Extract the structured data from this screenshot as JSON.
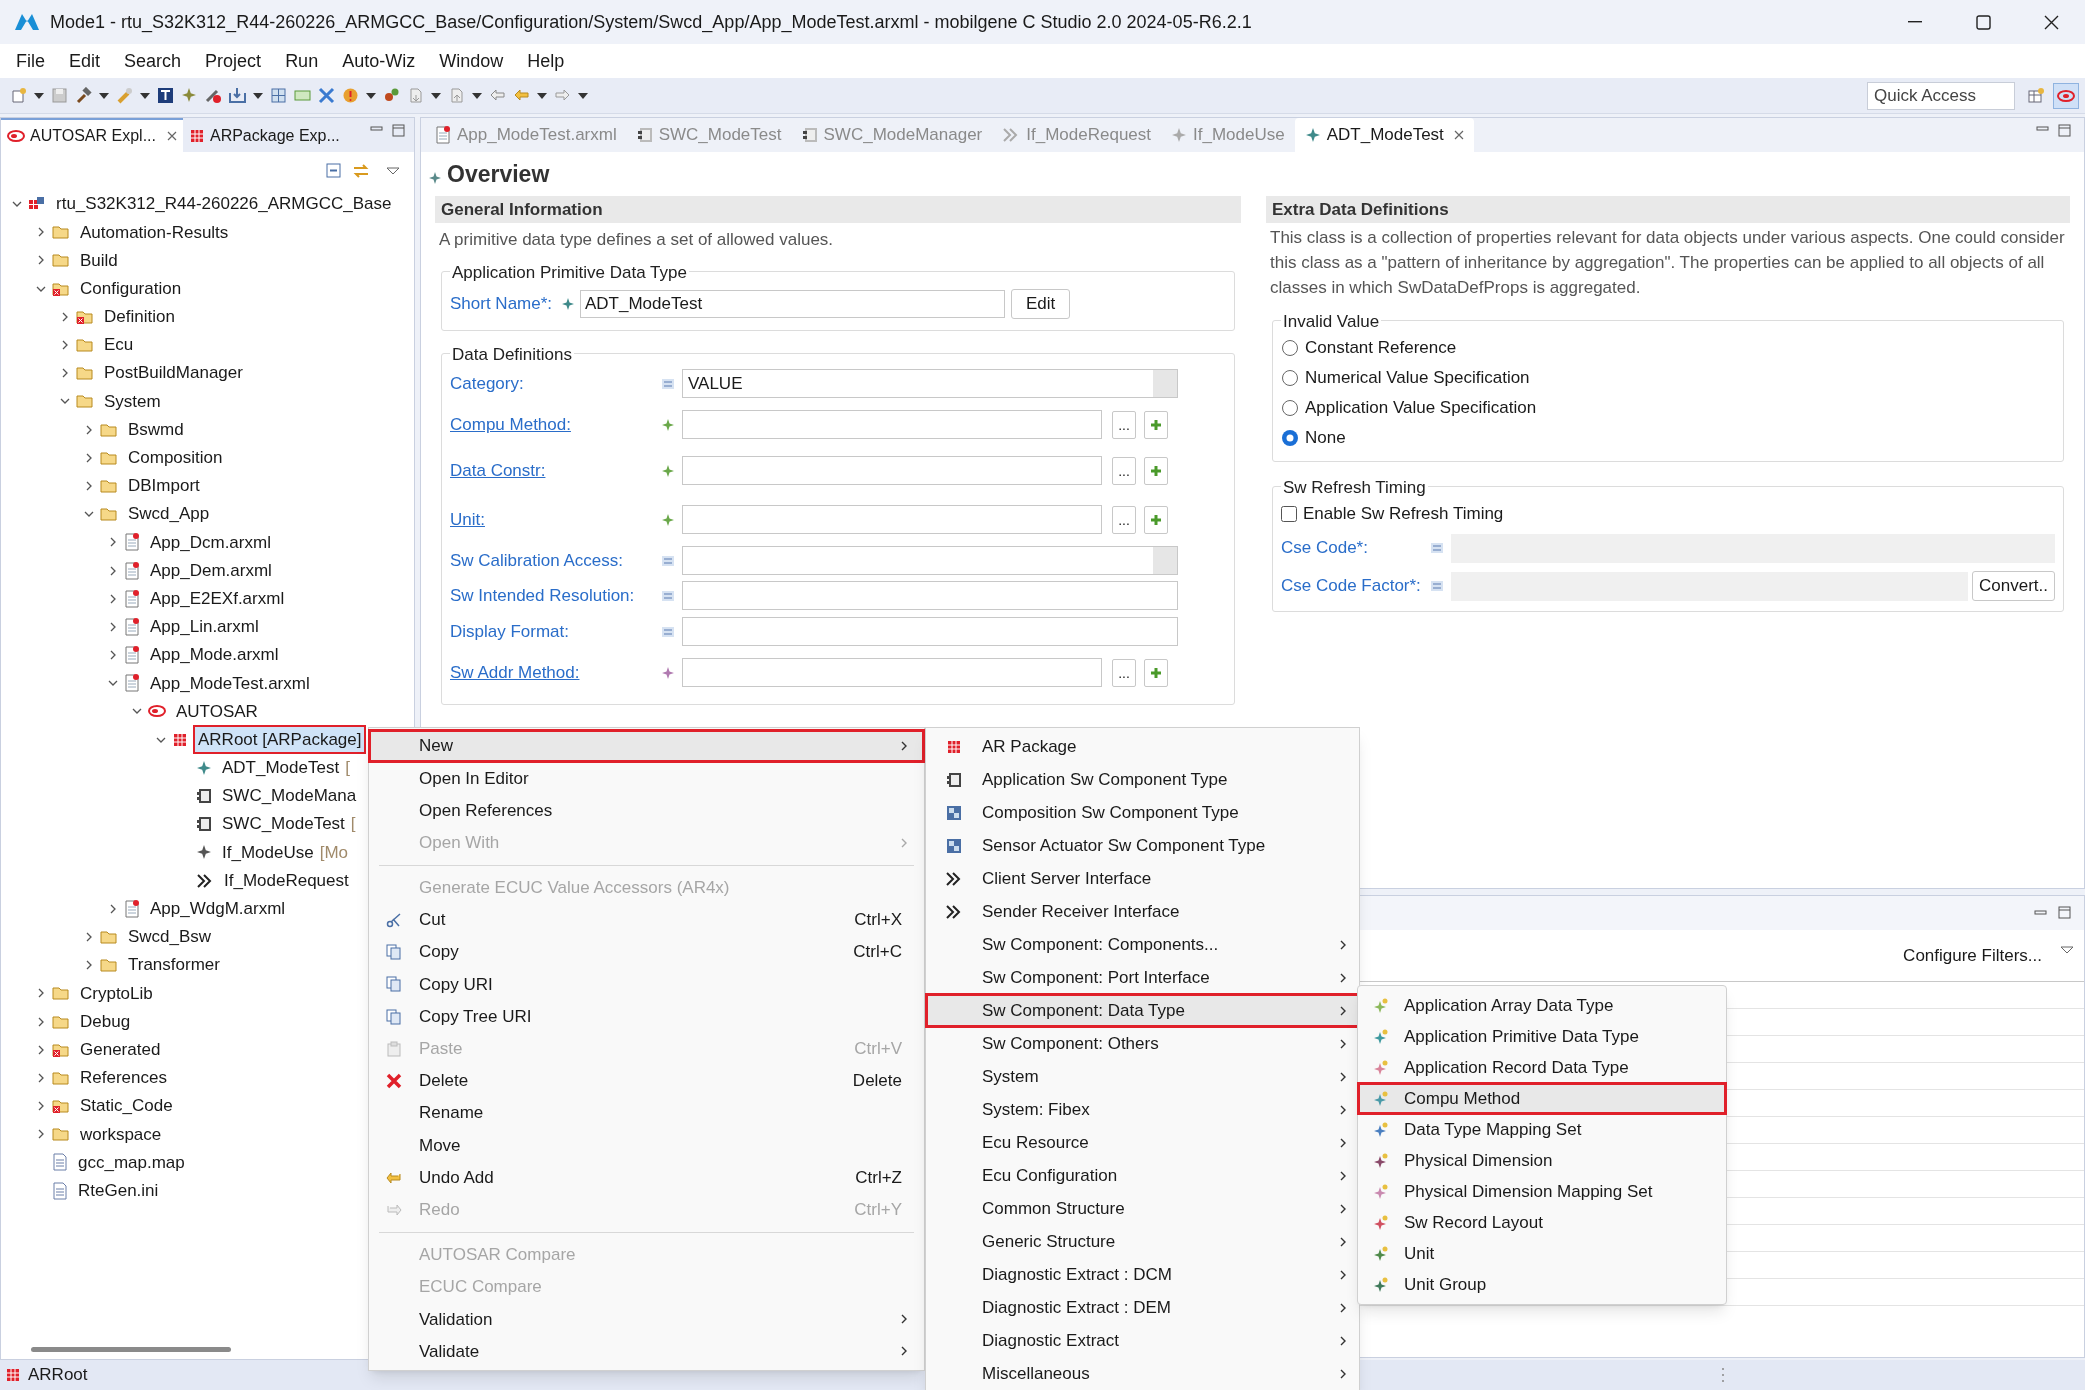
{
  "window": {
    "title": "Mode1 - rtu_S32K312_R44-260226_ARMGCC_Base/Configuration/System/Swcd_App/App_ModeTest.arxml - mobilgene C Studio 2.0 2024-05-R6.2.1"
  },
  "menu_bar": [
    "File",
    "Edit",
    "Search",
    "Project",
    "Run",
    "Auto-Wiz",
    "Window",
    "Help"
  ],
  "quick_access": {
    "placeholder": "Quick Access"
  },
  "left_tabs": [
    {
      "label": "AUTOSAR Expl...",
      "kind": "autosar",
      "selected": true
    },
    {
      "label": "ARPackage Exp...",
      "kind": "package",
      "selected": false
    }
  ],
  "tree": [
    {
      "label": "rtu_S32K312_R44-260226_ARMGCC_Base",
      "kind": "project",
      "expanded": true,
      "selected": false,
      "children": [
        {
          "label": "Automation-Results",
          "kind": "folder",
          "expanded": false,
          "selected": false
        },
        {
          "label": "Build",
          "kind": "folder",
          "expanded": false,
          "selected": false
        },
        {
          "label": "Configuration",
          "kind": "folder-error",
          "expanded": true,
          "selected": false,
          "children": [
            {
              "label": "Definition",
              "kind": "folder-error",
              "expanded": false,
              "selected": false
            },
            {
              "label": "Ecu",
              "kind": "folder",
              "expanded": false,
              "selected": false
            },
            {
              "label": "PostBuildManager",
              "kind": "folder",
              "expanded": false,
              "selected": false
            },
            {
              "label": "System",
              "kind": "folder",
              "expanded": true,
              "selected": false,
              "children": [
                {
                  "label": "Bswmd",
                  "kind": "folder",
                  "expanded": false,
                  "selected": false
                },
                {
                  "label": "Composition",
                  "kind": "folder",
                  "expanded": false,
                  "selected": false
                },
                {
                  "label": "DBImport",
                  "kind": "folder",
                  "expanded": false,
                  "selected": false
                },
                {
                  "label": "Swcd_App",
                  "kind": "folder",
                  "expanded": true,
                  "selected": false,
                  "children": [
                    {
                      "label": "App_Dcm.arxml",
                      "kind": "arxml",
                      "expanded": false,
                      "selected": false
                    },
                    {
                      "label": "App_Dem.arxml",
                      "kind": "arxml",
                      "expanded": false,
                      "selected": false
                    },
                    {
                      "label": "App_E2EXf.arxml",
                      "kind": "arxml",
                      "expanded": false,
                      "selected": false
                    },
                    {
                      "label": "App_Lin.arxml",
                      "kind": "arxml",
                      "expanded": false,
                      "selected": false
                    },
                    {
                      "label": "App_Mode.arxml",
                      "kind": "arxml",
                      "expanded": false,
                      "selected": false
                    },
                    {
                      "label": "App_ModeTest.arxml",
                      "kind": "arxml",
                      "expanded": true,
                      "selected": false,
                      "children": [
                        {
                          "label": "AUTOSAR",
                          "kind": "autosar",
                          "expanded": true,
                          "selected": false,
                          "children": [
                            {
                              "label": "ARRoot [ARPackage]",
                              "kind": "package",
                              "expanded": true,
                              "selected": true,
                              "children": [
                                {
                                  "label": "ADT_ModeTest",
                                  "suffix": "[",
                                  "kind": "datatype",
                                  "selected": false
                                },
                                {
                                  "label": "SWC_ModeMana",
                                  "kind": "component",
                                  "selected": false
                                },
                                {
                                  "label": "SWC_ModeTest",
                                  "suffix": "[",
                                  "kind": "component",
                                  "selected": false
                                },
                                {
                                  "label": "If_ModeUse",
                                  "suffix": "[Mo",
                                  "kind": "interface",
                                  "selected": false
                                },
                                {
                                  "label": "If_ModeRequest",
                                  "kind": "request",
                                  "selected": false
                                }
                              ]
                            }
                          ]
                        }
                      ]
                    },
                    {
                      "label": "App_WdgM.arxml",
                      "kind": "arxml",
                      "expanded": false,
                      "selected": false
                    }
                  ]
                },
                {
                  "label": "Swcd_Bsw",
                  "kind": "folder",
                  "expanded": false,
                  "selected": false
                },
                {
                  "label": "Transformer",
                  "kind": "folder",
                  "expanded": false,
                  "selected": false
                }
              ]
            }
          ]
        },
        {
          "label": "CryptoLib",
          "kind": "folder",
          "expanded": false,
          "selected": false
        },
        {
          "label": "Debug",
          "kind": "folder",
          "expanded": false,
          "selected": false
        },
        {
          "label": "Generated",
          "kind": "folder-error",
          "expanded": false,
          "selected": false
        },
        {
          "label": "References",
          "kind": "folder",
          "expanded": false,
          "selected": false
        },
        {
          "label": "Static_Code",
          "kind": "folder-error",
          "expanded": false,
          "selected": false
        },
        {
          "label": "workspace",
          "kind": "folder",
          "expanded": false,
          "selected": false
        },
        {
          "label": "gcc_map.map",
          "kind": "file",
          "selected": false
        },
        {
          "label": "RteGen.ini",
          "kind": "file",
          "selected": false
        }
      ]
    }
  ],
  "editor_tabs": [
    {
      "label": "App_ModeTest.arxml",
      "kind": "arxml",
      "selected": false
    },
    {
      "label": "SWC_ModeTest",
      "kind": "component",
      "selected": false
    },
    {
      "label": "SWC_ModeManager",
      "kind": "component",
      "selected": false
    },
    {
      "label": "If_ModeRequest",
      "kind": "request",
      "selected": false
    },
    {
      "label": "If_ModeUse",
      "kind": "interface",
      "selected": false
    },
    {
      "label": "ADT_ModeTest",
      "kind": "datatype",
      "selected": true
    }
  ],
  "overview": {
    "title": "Overview",
    "general": {
      "heading": "General Information",
      "description": "A primitive data type defines a set of allowed values.",
      "group": "Application Primitive Data Type",
      "short_name": {
        "label": "Short Name*:",
        "value": "ADT_ModeTest",
        "button": "Edit"
      },
      "data_group": "Data Definitions",
      "fields": [
        {
          "label": "Category:",
          "kind": "combo",
          "link": false,
          "value": "VALUE"
        },
        {
          "label": "Compu Method:",
          "kind": "reference",
          "link": true,
          "browse": "..."
        },
        {
          "label": "Data Constr:",
          "kind": "reference",
          "link": true,
          "browse": "..."
        },
        {
          "label": "Unit:",
          "kind": "reference",
          "link": true,
          "browse": "..."
        },
        {
          "label": "Sw Calibration Access:",
          "kind": "combo",
          "link": false
        },
        {
          "label": "Sw Intended Resolution:",
          "kind": "text",
          "link": false
        },
        {
          "label": "Display Format:",
          "kind": "text",
          "link": false
        },
        {
          "label": "Sw Addr Method:",
          "kind": "addr",
          "link": true,
          "browse": "..."
        }
      ]
    },
    "extra": {
      "heading": "Extra Data Definitions",
      "description": "This class is a collection of properties relevant for data objects under various aspects. One could consider this class as a \"pattern of inheritance by aggregation\". The properties can be applied to all objects of all classes in which SwDataDefProps is aggregated.",
      "invalid_value": {
        "label": "Invalid Value",
        "options": [
          {
            "label": "Constant Reference",
            "selected": false
          },
          {
            "label": "Numerical Value Specification",
            "selected": false
          },
          {
            "label": "Application Value Specification",
            "selected": false
          },
          {
            "label": "None",
            "selected": true
          }
        ]
      },
      "refresh": {
        "label": "Sw Refresh Timing",
        "checkbox": {
          "label": "Enable Sw Refresh Timing",
          "checked": false
        },
        "fields": [
          {
            "label": "Cse Code*:",
            "disabled": true
          },
          {
            "label": "Cse Code Factor*:",
            "disabled": true,
            "button": "Convert.."
          }
        ]
      }
    }
  },
  "lower_panel": {
    "filter_button": "Configure Filters..."
  },
  "context_menu": [
    {
      "label": "New",
      "kind": "plain",
      "submenu": true,
      "disabled": false,
      "selected": true
    },
    {
      "label": "Open In Editor",
      "kind": "plain",
      "disabled": false,
      "selected": false
    },
    {
      "label": "Open References",
      "kind": "plain",
      "disabled": false,
      "selected": false
    },
    {
      "label": "Open With",
      "kind": "plain",
      "submenu": true,
      "disabled": true,
      "selected": false
    },
    {
      "kind": "separator"
    },
    {
      "label": "Generate ECUC Value Accessors (AR4x)",
      "kind": "plain",
      "disabled": true,
      "selected": false
    },
    {
      "label": "Cut",
      "shortcut": "Ctrl+X",
      "kind": "cut",
      "disabled": false,
      "selected": false
    },
    {
      "label": "Copy",
      "shortcut": "Ctrl+C",
      "kind": "copy",
      "disabled": false,
      "selected": false
    },
    {
      "label": "Copy URI",
      "kind": "copy",
      "disabled": false,
      "selected": false
    },
    {
      "label": "Copy Tree URI",
      "kind": "copy",
      "disabled": false,
      "selected": false
    },
    {
      "label": "Paste",
      "shortcut": "Ctrl+V",
      "kind": "paste",
      "disabled": true,
      "selected": false
    },
    {
      "label": "Delete",
      "shortcut": "Delete",
      "kind": "delete",
      "disabled": false,
      "selected": false
    },
    {
      "label": "Rename",
      "kind": "plain",
      "disabled": false,
      "selected": false
    },
    {
      "label": "Move",
      "kind": "plain",
      "disabled": false,
      "selected": false
    },
    {
      "label": "Undo Add",
      "shortcut": "Ctrl+Z",
      "kind": "undo",
      "disabled": false,
      "selected": false
    },
    {
      "label": "Redo",
      "shortcut": "Ctrl+Y",
      "kind": "redo",
      "disabled": true,
      "selected": false
    },
    {
      "kind": "separator"
    },
    {
      "label": "AUTOSAR Compare",
      "kind": "plain",
      "disabled": true,
      "selected": false
    },
    {
      "label": "ECUC Compare",
      "kind": "plain",
      "disabled": true,
      "selected": false
    },
    {
      "label": "Validation",
      "kind": "plain",
      "submenu": true,
      "disabled": false,
      "selected": false
    },
    {
      "label": "Validate",
      "kind": "plain",
      "submenu": true,
      "disabled": false,
      "selected": false
    }
  ],
  "new_submenu": [
    {
      "label": "AR Package",
      "kind": "package",
      "selected": false
    },
    {
      "label": "Application Sw Component Type",
      "kind": "component",
      "selected": false
    },
    {
      "label": "Composition Sw Component Type",
      "kind": "composition",
      "selected": false
    },
    {
      "label": "Sensor Actuator Sw Component Type",
      "kind": "composition",
      "selected": false
    },
    {
      "label": "Client Server Interface",
      "kind": "request",
      "selected": false
    },
    {
      "label": "Sender Receiver Interface",
      "kind": "request",
      "selected": false
    },
    {
      "label": "Sw Component: Components...",
      "kind": "submenu",
      "selected": false
    },
    {
      "label": "Sw Component: Port Interface",
      "kind": "submenu",
      "selected": false
    },
    {
      "label": "Sw Component: Data Type",
      "kind": "submenu",
      "selected": true
    },
    {
      "label": "Sw Component: Others",
      "kind": "submenu",
      "selected": false
    },
    {
      "label": "System",
      "kind": "submenu",
      "selected": false
    },
    {
      "label": "System: Fibex",
      "kind": "submenu",
      "selected": false
    },
    {
      "label": "Ecu Resource",
      "kind": "submenu",
      "selected": false
    },
    {
      "label": "Ecu Configuration",
      "kind": "submenu",
      "selected": false
    },
    {
      "label": "Common Structure",
      "kind": "submenu",
      "selected": false
    },
    {
      "label": "Generic Structure",
      "kind": "submenu",
      "selected": false
    },
    {
      "label": "Diagnostic Extract : DCM",
      "kind": "submenu",
      "selected": false
    },
    {
      "label": "Diagnostic Extract : DEM",
      "kind": "submenu",
      "selected": false
    },
    {
      "label": "Diagnostic Extract",
      "kind": "submenu",
      "selected": false
    },
    {
      "label": "Miscellaneous",
      "kind": "submenu",
      "selected": false
    }
  ],
  "data_type_submenu": [
    {
      "label": "Application Array Data Type",
      "color": "#8cb85a",
      "selected": false
    },
    {
      "label": "Application Primitive Data Type",
      "color": "#3f9aa0",
      "selected": false
    },
    {
      "label": "Application Record Data Type",
      "color": "#d9849a",
      "selected": false
    },
    {
      "label": "Compu Method",
      "color": "#4a9aa8",
      "selected": true
    },
    {
      "label": "Data Type Mapping Set",
      "color": "#4a7fc0",
      "selected": false
    },
    {
      "label": "Physical Dimension",
      "color": "#8a4a6a",
      "selected": false
    },
    {
      "label": "Physical Dimension Mapping Set",
      "color": "#c98ab0",
      "selected": false
    },
    {
      "label": "Sw Record Layout",
      "color": "#d05060",
      "selected": false
    },
    {
      "label": "Unit",
      "color": "#4f8a4a",
      "selected": false
    },
    {
      "label": "Unit Group",
      "color": "#3f7a5a",
      "selected": false
    }
  ],
  "status_bar": {
    "label": "ARRoot"
  }
}
